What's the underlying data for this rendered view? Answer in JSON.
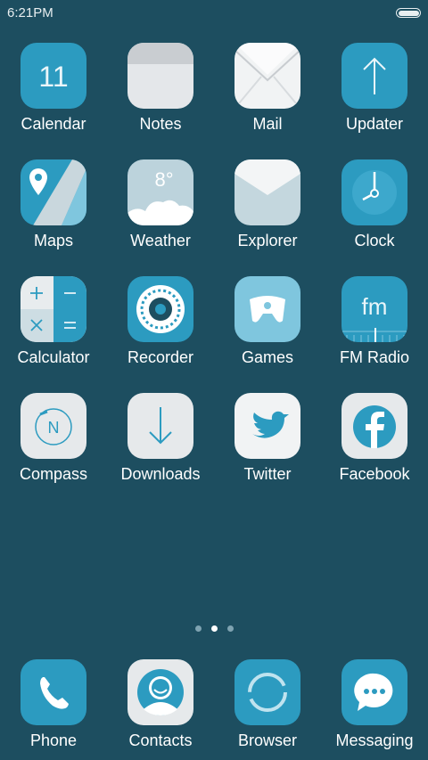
{
  "status_bar": {
    "time": "6:21PM"
  },
  "apps": [
    [
      {
        "name": "calendar",
        "label": "Calendar",
        "icon": "calendar-icon",
        "date": "11"
      },
      {
        "name": "notes",
        "label": "Notes",
        "icon": "notes-icon"
      },
      {
        "name": "mail",
        "label": "Mail",
        "icon": "mail-icon"
      },
      {
        "name": "updater",
        "label": "Updater",
        "icon": "updater-arrow-icon"
      }
    ],
    [
      {
        "name": "maps",
        "label": "Maps",
        "icon": "map-pin-icon"
      },
      {
        "name": "weather",
        "label": "Weather",
        "icon": "weather-cloud-icon",
        "temp": "8°"
      },
      {
        "name": "explorer",
        "label": "Explorer",
        "icon": "envelope-folder-icon"
      },
      {
        "name": "clock",
        "label": "Clock",
        "icon": "clock-icon"
      }
    ],
    [
      {
        "name": "calculator",
        "label": "Calculator",
        "icon": "calculator-icon"
      },
      {
        "name": "recorder",
        "label": "Recorder",
        "icon": "recorder-icon"
      },
      {
        "name": "games",
        "label": "Games",
        "icon": "gamepad-icon"
      },
      {
        "name": "fm-radio",
        "label": "FM Radio",
        "icon": "radio-icon",
        "text": "fm"
      }
    ],
    [
      {
        "name": "compass",
        "label": "Compass",
        "icon": "compass-icon",
        "letter": "N"
      },
      {
        "name": "downloads",
        "label": "Downloads",
        "icon": "download-arrow-icon"
      },
      {
        "name": "twitter",
        "label": "Twitter",
        "icon": "twitter-bird-icon"
      },
      {
        "name": "facebook",
        "label": "Facebook",
        "icon": "facebook-icon"
      }
    ]
  ],
  "page_indicator": {
    "count": 3,
    "active": 1
  },
  "dock": [
    {
      "name": "phone",
      "label": "Phone",
      "icon": "phone-icon"
    },
    {
      "name": "contacts",
      "label": "Contacts",
      "icon": "contacts-icon"
    },
    {
      "name": "browser",
      "label": "Browser",
      "icon": "browser-icon"
    },
    {
      "name": "messaging",
      "label": "Messaging",
      "icon": "chat-bubble-icon"
    }
  ]
}
